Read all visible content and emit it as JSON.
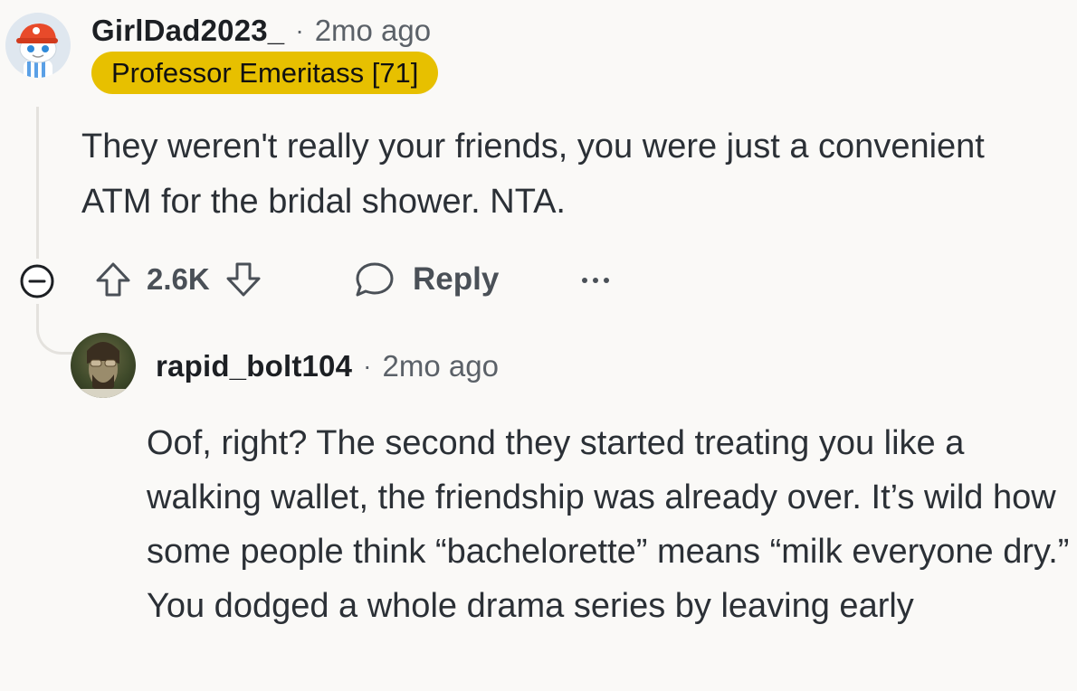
{
  "comment": {
    "username": "GirlDad2023_",
    "separator": "·",
    "time_ago": "2mo ago",
    "flair": "Professor Emeritass [71]",
    "body": "They weren't really your friends, you were just a convenient ATM for the bridal shower. NTA.",
    "score": "2.6K",
    "reply_label": "Reply",
    "more_label": "···"
  },
  "reply": {
    "username": "rapid_bolt104",
    "separator": "·",
    "time_ago": "2mo ago",
    "body": "Oof, right? The second they started treating you like a walking wallet, the friendship was already over. It’s wild how some people think “bachelorette” means “milk everyone dry.” You dodged a whole drama series by leaving early"
  },
  "icons": {
    "collapse": "collapse-minus-icon",
    "upvote": "upvote-arrow-icon",
    "downvote": "downvote-arrow-icon",
    "reply": "speech-bubble-icon",
    "more": "ellipsis-icon"
  },
  "colors": {
    "background": "#faf9f7",
    "flair_bg": "#e7c000",
    "text_primary": "#1c1f23",
    "text_secondary": "#5b6168",
    "thread_line": "#e4e2de"
  }
}
